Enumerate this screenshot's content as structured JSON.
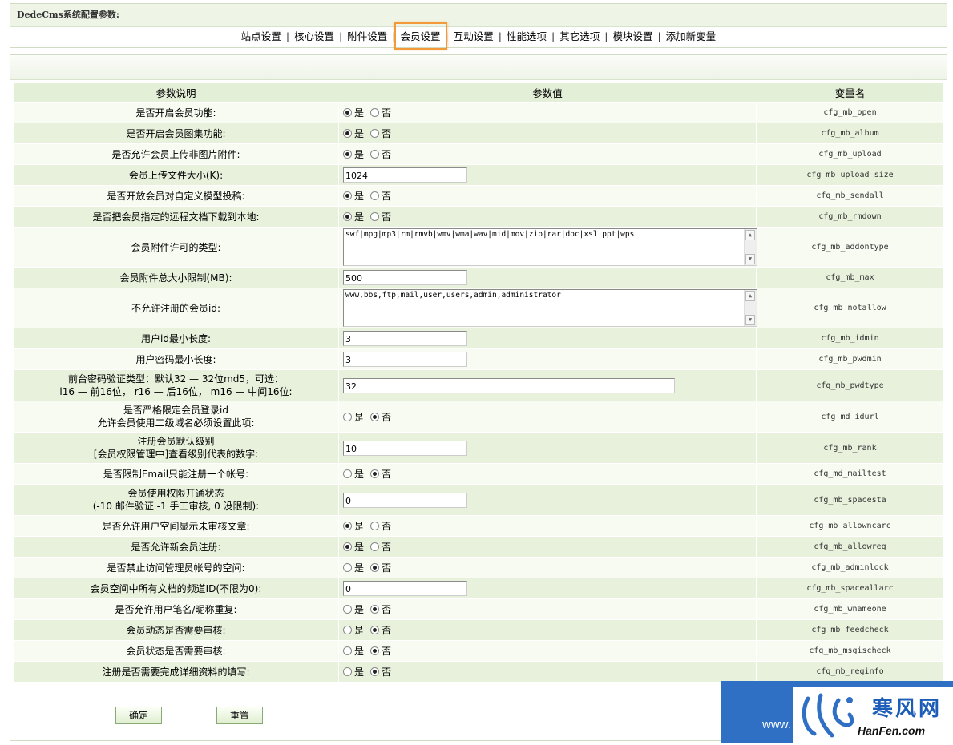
{
  "header": {
    "title": "DedeCms系统配置参数:"
  },
  "tabs": [
    {
      "label": "站点设置",
      "active": false
    },
    {
      "label": "核心设置",
      "active": false
    },
    {
      "label": "附件设置",
      "active": false
    },
    {
      "label": "会员设置",
      "active": true
    },
    {
      "label": "互动设置",
      "active": false
    },
    {
      "label": "性能选项",
      "active": false
    },
    {
      "label": "其它选项",
      "active": false
    },
    {
      "label": "模块设置",
      "active": false
    },
    {
      "label": "添加新变量",
      "active": false
    }
  ],
  "table": {
    "headers": [
      "参数说明",
      "参数值",
      "变量名"
    ],
    "radio_yes": "是",
    "radio_no": "否",
    "rows": [
      {
        "desc": "是否开启会员功能:",
        "type": "radio",
        "value": "yes",
        "var": "cfg_mb_open"
      },
      {
        "desc": "是否开启会员图集功能:",
        "type": "radio",
        "value": "yes",
        "var": "cfg_mb_album"
      },
      {
        "desc": "是否允许会员上传非图片附件:",
        "type": "radio",
        "value": "yes",
        "var": "cfg_mb_upload"
      },
      {
        "desc": "会员上传文件大小(K):",
        "type": "text",
        "value": "1024",
        "var": "cfg_mb_upload_size"
      },
      {
        "desc": "是否开放会员对自定义模型投稿:",
        "type": "radio",
        "value": "yes",
        "var": "cfg_mb_sendall"
      },
      {
        "desc": "是否把会员指定的远程文档下载到本地:",
        "type": "radio",
        "value": "yes",
        "var": "cfg_mb_rmdown"
      },
      {
        "desc": "会员附件许可的类型:",
        "type": "textarea",
        "value": "swf|mpg|mp3|rm|rmvb|wmv|wma|wav|mid|mov|zip|rar|doc|xsl|ppt|wps",
        "var": "cfg_mb_addontype"
      },
      {
        "desc": "会员附件总大小限制(MB):",
        "type": "text",
        "value": "500",
        "var": "cfg_mb_max"
      },
      {
        "desc": "不允许注册的会员id:",
        "type": "textarea",
        "value": "www,bbs,ftp,mail,user,users,admin,administrator",
        "var": "cfg_mb_notallow"
      },
      {
        "desc": "用户id最小长度:",
        "type": "text",
        "value": "3",
        "var": "cfg_mb_idmin"
      },
      {
        "desc": "用户密码最小长度:",
        "type": "text",
        "value": "3",
        "var": "cfg_mb_pwdmin"
      },
      {
        "desc": "前台密码验证类型：默认32 — 32位md5，可选：",
        "desc2": "l16 — 前16位， r16 — 后16位， m16 — 中间16位:",
        "type": "textwide",
        "value": "32",
        "var": "cfg_mb_pwdtype"
      },
      {
        "desc": "是否严格限定会员登录id",
        "desc2": "允许会员使用二级域名必须设置此项:",
        "type": "radio",
        "value": "no",
        "var": "cfg_md_idurl"
      },
      {
        "desc": "注册会员默认级别",
        "desc2": "[会员权限管理中]查看级别代表的数字:",
        "type": "text",
        "value": "10",
        "var": "cfg_mb_rank"
      },
      {
        "desc": "是否限制Email只能注册一个帐号:",
        "type": "radio",
        "value": "no",
        "var": "cfg_md_mailtest"
      },
      {
        "desc": "会员使用权限开通状态",
        "desc2": "(-10 邮件验证 -1 手工审核, 0 没限制):",
        "type": "text",
        "value": "0",
        "var": "cfg_mb_spacesta"
      },
      {
        "desc": "是否允许用户空间显示未审核文章:",
        "type": "radio",
        "value": "yes",
        "var": "cfg_mb_allowncarc"
      },
      {
        "desc": "是否允许新会员注册:",
        "type": "radio",
        "value": "yes",
        "var": "cfg_mb_allowreg"
      },
      {
        "desc": "是否禁止访问管理员帐号的空间:",
        "type": "radio",
        "value": "no",
        "var": "cfg_mb_adminlock"
      },
      {
        "desc": "会员空间中所有文档的频道ID(不限为0):",
        "type": "text",
        "value": "0",
        "var": "cfg_mb_spaceallarc"
      },
      {
        "desc": "是否允许用户笔名/昵称重复:",
        "type": "radio",
        "value": "no",
        "var": "cfg_mb_wnameone"
      },
      {
        "desc": "会员动态是否需要审核:",
        "type": "radio",
        "value": "no",
        "var": "cfg_mb_feedcheck"
      },
      {
        "desc": "会员状态是否需要审核:",
        "type": "radio",
        "value": "no",
        "var": "cfg_mb_msgischeck"
      },
      {
        "desc": "注册是否需要完成详细资料的填写:",
        "type": "radio",
        "value": "no",
        "var": "cfg_mb_reginfo"
      }
    ]
  },
  "buttons": {
    "confirm": "确定",
    "reset": "重置"
  },
  "watermark": {
    "www": "www.",
    "brand": "寒风网",
    "domain": "HanFen.com"
  }
}
